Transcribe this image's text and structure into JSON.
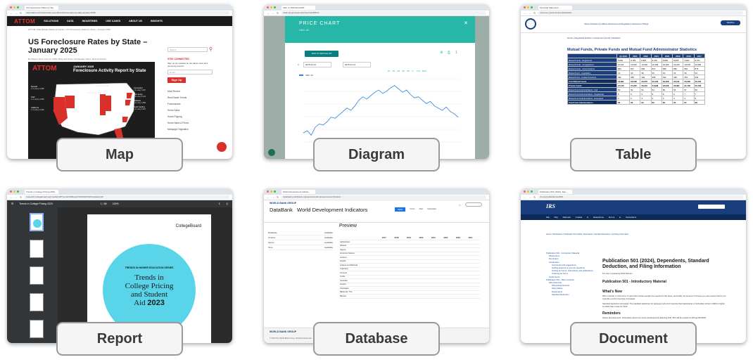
{
  "tiles": [
    {
      "caption": "Map",
      "tab": "US Foreclosure Rates by Sta",
      "url": "attomdata.com/news/most-recent/foreclosure-rates-by-state-january-2025/",
      "logo": "ATTOM",
      "nav": [
        "SOLUTIONS",
        "DATA",
        "INDUSTRIES",
        "USE CASES",
        "ABOUT US",
        "INSIGHTS"
      ],
      "breadcrumb": "ATTOM / Real Estate Market & Articles / US Foreclosure Rates by State – January 2025",
      "title": "US Foreclosure Rates by State – January 2025",
      "byline": "By Megan Hunt | Feb 13, 2025 | Blog and Policy, Real Estate News, Recent Articles",
      "card_month": "JANUARY 2025",
      "card_title": "Foreclosure Activity Report by State",
      "search_placeholder": "Search",
      "stay_connected": "STAY CONNECTED",
      "stay_text": "Sign up for updates on the latest news and upcoming events!",
      "email_placeholder": "Email",
      "signup": "Sign Up",
      "most_recent": "Most Recent",
      "trends_head": "Real Estate Trends",
      "links": [
        "Foreclosures",
        "Home Sales",
        "Home Flipping",
        "Home Sales & Prices",
        "Mortgage Origination"
      ],
      "callouts": [
        {
          "state": "Nevada",
          "rate": "1 in every 2,308"
        },
        {
          "state": "Utah",
          "rate": "1 in every 3,035"
        },
        {
          "state": "California",
          "rate": "1 in every 3,449"
        },
        {
          "state": "Illinois",
          "rate": "1 in every 2,788"
        },
        {
          "state": "Indiana",
          "rate": "1 in every 2,465"
        },
        {
          "state": "Connecticut",
          "rate": "1 in every 3,007"
        },
        {
          "state": "New Jersey",
          "rate": "1 in every 2,442"
        },
        {
          "state": "Delaware",
          "rate": "1 in every 2,889"
        },
        {
          "state": "South Carolina",
          "rate": "1 in every 2,847"
        },
        {
          "state": "Florida",
          "rate": "1 in every 2,375"
        }
      ]
    },
    {
      "caption": "Diagram",
      "tab": "CEC 4 | PRICECHART",
      "url": "data.eia.gov/openapi/pricechart/NBC4",
      "title": "PRICE CHART",
      "subtitle": "CEC 4C",
      "button": "ADD TO WATCHLIST",
      "date_from": "2025-03-01",
      "date_to": "2025-03-31",
      "ranges": [
        "1D",
        "5D",
        "1M",
        "3M",
        "6M",
        "1Y",
        "YTD",
        "MAX"
      ],
      "legend": "CEC 4C"
    },
    {
      "caption": "Table",
      "tab": "Financial Statement ...",
      "url": "www.sec.gov/investment/statistics",
      "nav": "About   Divisions & Offices   Enforcement   Regulation   Newsroom   Filings",
      "breadcrumb": "Home  |  Regulated Entities  |  Investment Funds  |  Statistics",
      "button": "SEARCH",
      "title": "Mutual Funds, Private Funds and Mutual Fund Administrator Statistics",
      "columns": [
        "",
        "Q1 2024",
        "2023",
        "2022",
        "2021",
        "2020",
        "2019",
        "2018",
        "2017"
      ],
      "rows": [
        [
          "Mutual Funds - Registered",
          "8,693",
          "8,765",
          "8,887",
          "8,765",
          "8,869",
          "8,878",
          "9,003",
          "9,071"
        ],
        [
          "Mutual Funds - Unregistered",
          "10,101",
          "10,183",
          "10,246",
          "10,183",
          "10,183",
          "10,215",
          "10,278",
          "10,360"
        ],
        [
          "Mutual Funds - Administrators",
          "804",
          "817",
          "839",
          "817",
          "830",
          "850",
          "862",
          "875"
        ],
        [
          "Mutual Fund - Liquidation",
          "41",
          "40",
          "39",
          "36",
          "34",
          "33",
          "36",
          "34"
        ],
        [
          "Mutual Fund - Limited Investors",
          "352",
          "363",
          "364",
          "355",
          "342",
          "335",
          "351",
          "362"
        ],
        [
          "Total Mutual Funds",
          "19,991",
          "20,168",
          "20,375",
          "20,156",
          "20,258",
          "20,311",
          "20,530",
          "20,702"
        ],
        [
          "Private Funds",
          "27,370",
          "27,260",
          "26,310",
          "24,938",
          "23,816",
          "22,661",
          "21,702",
          "20,706"
        ],
        [
          "Mutual Fund Administrators - Full",
          "54",
          "54",
          "54",
          "54",
          "56",
          "56",
          "57",
          "58"
        ],
        [
          "Mutual Fund Administrators - Registered",
          "5",
          "5",
          "5",
          "5",
          "6",
          "6",
          "7",
          "7"
        ],
        [
          "Mutual Fund Administrators - Exempted",
          "3",
          "3",
          "3",
          "3",
          "3",
          "3",
          "3",
          "3"
        ],
        [
          "Total Fund Administrators",
          "62",
          "62",
          "62",
          "62",
          "65",
          "65",
          "67",
          "68"
        ]
      ]
    },
    {
      "caption": "Report",
      "tab": "Trends in College Pricing 2023",
      "url": "research.collegeboard.org/media/pdf/Trends%20Report%202023%20Updated.pdf",
      "doc_name": "Trends in College Pricing 2023",
      "page_readout": "1 / 56",
      "zoom": "100%",
      "brand": "CollegeBoard",
      "series": "TRENDS IN HIGHER EDUCATION SERIES",
      "title_lines": [
        "Trends in",
        "College Pricing",
        "and Student"
      ],
      "title_last": "Aid",
      "title_year": "2023"
    },
    {
      "caption": "Database",
      "tab": "World Development Indicat...",
      "url": "databank.worldbank.org/source/world-development-indicators",
      "brand": "WORLD BANK GROUP",
      "bank": "DataBank",
      "title": "World Development Indicators",
      "preview": "Preview",
      "tabs": [
        "Table",
        "Chart",
        "Map",
        "Metadata"
      ],
      "left_rows": [
        {
          "label": "Database",
          "value": "Available"
        },
        {
          "label": "Country",
          "value": "Available"
        },
        {
          "label": "Series",
          "value": "Available"
        },
        {
          "label": "Time",
          "value": "Available"
        }
      ],
      "years": [
        "2017",
        "2018",
        "2019",
        "2020",
        "2021",
        "2022",
        "2023",
        "2024"
      ],
      "countries": [
        "Afghanistan",
        "Albania",
        "Algeria",
        "American Samoa",
        "Andorra",
        "Angola",
        "Antigua and Barbuda",
        "Argentina",
        "Armenia",
        "Aruba",
        "Australia",
        "Austria",
        "Azerbaijan",
        "Bahamas, The",
        "Bahrain"
      ],
      "footer": "© 2025 The World Bank Group, All Rights Reserved."
    },
    {
      "caption": "Document",
      "tab": "Publication 501 (2024), Dep...",
      "url": "irs.gov/publications/p501",
      "logo": "IRS",
      "topnav": "File  Pay  Refunds  Credits & Deductions  Forms & Instructions",
      "breadcrumb": "Home / Publications / Publication 501 (2024), Dependents, Standard Deduction, and Filing Information",
      "title": "Publication 501 (2024), Dependents, Standard Deduction, and Filing Information",
      "note": "For use in preparing 2024 Returns",
      "sub1": "Publication 501 - Introductory Material",
      "sub2": "What's New",
      "p1": "Who must file. It is the time of year when certain people are required to file taxes. Generally, the amount of income you can receive before you must file a return has been increased.",
      "p2": "Standard deduction increased. The standard deduction for taxpayers who don't itemize their deductions on Schedule A (Form 1040) is higher for 2024 than it was for 2023.",
      "sub3": "Reminders",
      "p3": "Future developments. Information about any future developments affecting Pub. 501 will be posted on IRS.gov/Pub501.",
      "toc": [
        "Publication 501 - Introductory Material",
        "What's New",
        "Reminders",
        "Introduction",
        "Comments and suggestions",
        "Getting answers to your tax questions",
        "Getting tax forms, instructions, and publications",
        "Ordering tax forms",
        "Useful Items",
        "Publication 501 - Main Contents",
        "Who Must File",
        "Filing Requirements",
        "Filing Status",
        "Dependents",
        "Standard Deduction"
      ]
    }
  ],
  "chart_line": [
    3.1,
    3.2,
    3.0,
    3.35,
    3.5,
    3.45,
    3.6,
    3.8,
    3.75,
    3.9,
    4.05,
    4.2,
    4.1,
    4.3,
    4.55,
    4.7,
    4.6,
    4.75,
    4.9,
    5.0,
    4.85,
    4.95,
    5.1,
    5.2,
    5.05,
    4.9,
    5.0,
    4.8,
    4.65,
    4.7,
    4.55,
    4.4,
    4.5,
    4.3,
    4.2,
    4.1,
    4.25,
    4.05,
    3.95,
    3.8
  ],
  "colors": {
    "attom_red": "#e0322c",
    "teal": "#26b7a8",
    "sec_blue": "#1b3e7c",
    "irs_blue": "#1a3e7d",
    "cb_cyan": "#59d4e8"
  }
}
